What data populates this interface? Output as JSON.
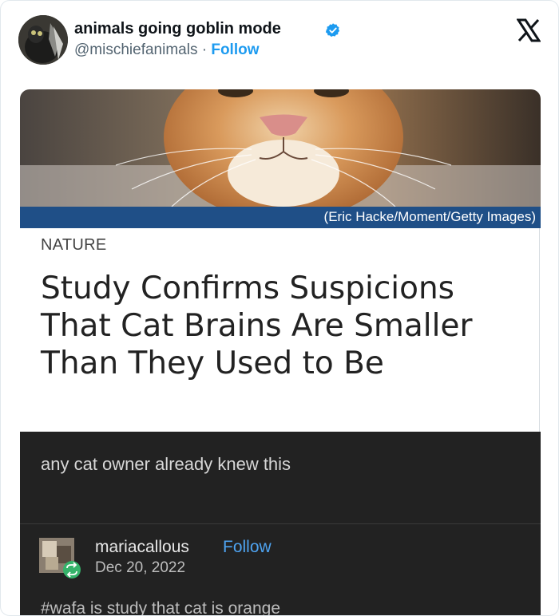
{
  "tweet": {
    "author_name": "animals going goblin mode",
    "handle": "@mischiefanimals",
    "separator": "·",
    "follow_label": "Follow"
  },
  "embed": {
    "photo_credit": "(Eric Hacke/Moment/Getty Images)",
    "section": "NATURE",
    "headline": "Study Confirms Suspicions That Cat Brains Are Smaller Than They Used to Be",
    "comment": "any cat owner already knew this",
    "repost_user": {
      "username": "mariacallous",
      "follow_label": "Follow",
      "date": "Dec 20, 2022"
    },
    "truncated_text": "#wafa is study that cat is orange"
  },
  "colors": {
    "follow_blue": "#1d9bf0",
    "caption_bar": "#1f4f87",
    "dark_panel": "#222222",
    "verified_badge": "#1d9bf0"
  },
  "icons": [
    "verified-badge-icon",
    "x-logo-icon",
    "reblog-icon"
  ]
}
